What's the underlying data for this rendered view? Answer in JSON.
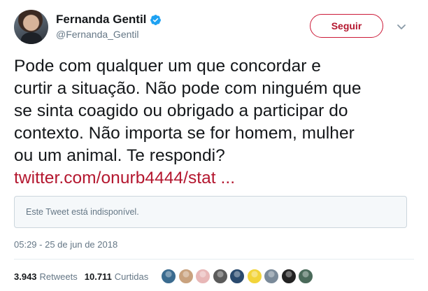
{
  "author": {
    "display_name": "Fernanda Gentil",
    "handle": "@Fernanda_Gentil",
    "verified": true
  },
  "follow_button": {
    "label": "Seguir"
  },
  "tweet": {
    "lines": [
      "Pode com qualquer um que concordar e",
      "curtir a situação. Não pode com ninguém que",
      "se sinta coagido ou obrigado a participar do",
      "contexto. Não importa se for homem, mulher",
      "ou um animal. Te respondi?"
    ],
    "link": "twitter.com/onurb4444/stat ..."
  },
  "quoted_card": {
    "text": "Este Tweet está indisponível."
  },
  "timestamp": "05:29 - 25 de jun de 2018",
  "stats": {
    "retweets_count": "3.943",
    "retweets_label": "Retweets",
    "likes_count": "10.711",
    "likes_label": "Curtidas"
  },
  "colors": {
    "accent": "#b4172f",
    "verified": "#1da1f2",
    "muted_text": "#657786"
  },
  "liker_avatars": [
    {
      "name": "liker-avatar-1",
      "color": "#3a6b8f"
    },
    {
      "name": "liker-avatar-2",
      "color": "#c9a27e"
    },
    {
      "name": "liker-avatar-3",
      "color": "#e8b7b7"
    },
    {
      "name": "liker-avatar-4",
      "color": "#5a5a5a"
    },
    {
      "name": "liker-avatar-5",
      "color": "#2a4a6e"
    },
    {
      "name": "liker-avatar-6",
      "color": "#f2d43a"
    },
    {
      "name": "liker-avatar-7",
      "color": "#7a8a99"
    },
    {
      "name": "liker-avatar-8",
      "color": "#222222"
    },
    {
      "name": "liker-avatar-9",
      "color": "#4a6a5a"
    }
  ]
}
